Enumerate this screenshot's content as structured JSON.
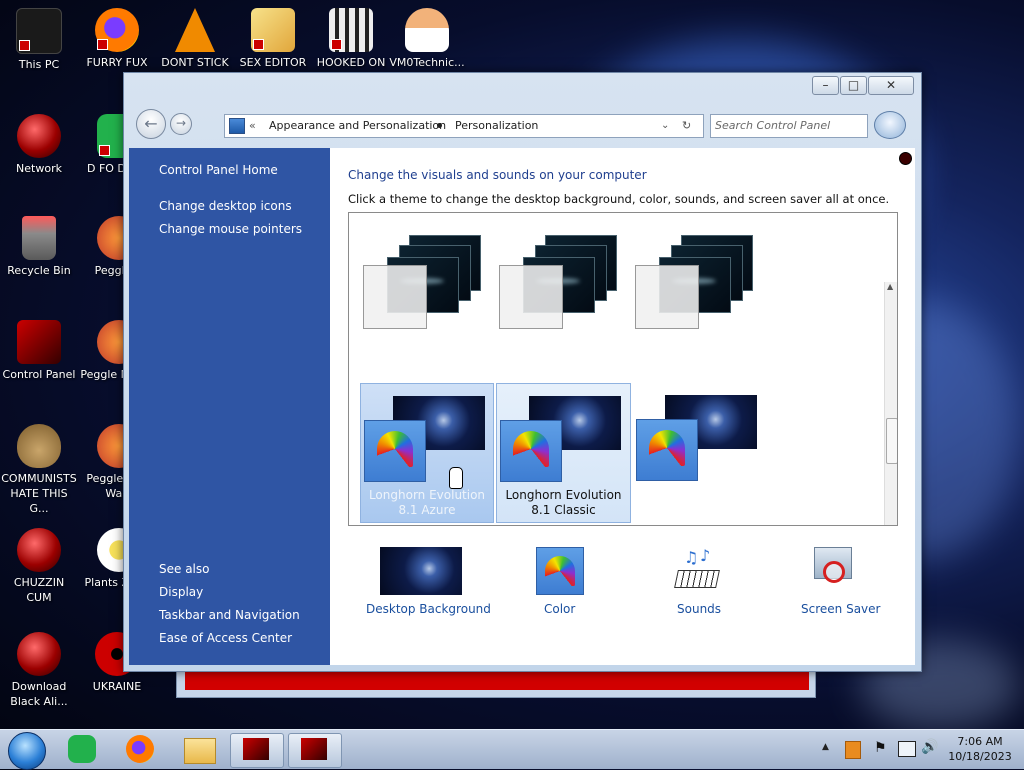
{
  "desktop": {
    "icons": [
      {
        "label": "This PC"
      },
      {
        "label": "FURRY FUX"
      },
      {
        "label": "DONT STICK"
      },
      {
        "label": "SEX EDITOR"
      },
      {
        "label": "HOOKED ON"
      },
      {
        "label": "VM0Technic..."
      },
      {
        "label": "Network"
      },
      {
        "label": "D FO DUMB"
      },
      {
        "label": "Recycle Bin"
      },
      {
        "label": "Peggle D"
      },
      {
        "label": "Control Panel"
      },
      {
        "label": "Peggle N Delu"
      },
      {
        "label": "COMMUNISTS HATE THIS G..."
      },
      {
        "label": "Peggle W of Warc"
      },
      {
        "label": "CHUZZIN CUM"
      },
      {
        "label": "Plants Zomb"
      },
      {
        "label": "Download Black Ali..."
      },
      {
        "label": "UKRAINE"
      }
    ]
  },
  "window": {
    "address": {
      "sep": "«",
      "crumb1": "Appearance and Personalization",
      "crumb2": "Personalization"
    },
    "search_placeholder": "Search Control Panel",
    "sidebar": {
      "home": "Control Panel Home",
      "links": [
        "Change desktop icons",
        "Change mouse pointers"
      ],
      "see_also_title": "See also",
      "see_also": [
        "Display",
        "Taskbar and Navigation",
        "Ease of Access Center"
      ]
    },
    "main": {
      "heading": "Change the visuals and sounds on your computer",
      "subheading": "Click a theme to change the desktop background, color, sounds, and screen saver all at once.",
      "themes": [
        {
          "name": "Longhorn Evolution 8.1 Azure"
        },
        {
          "name": "Longhorn Evolution 8.1 Classic"
        }
      ],
      "bottom": [
        "Desktop Background",
        "Color",
        "Sounds",
        "Screen Saver"
      ]
    }
  },
  "taskbar": {
    "time": "7:06 AM",
    "date": "10/18/2023"
  },
  "colors": {
    "left_pane": "#2f55a4",
    "link": "#1a4f9e",
    "heading": "#1f3f8f"
  }
}
